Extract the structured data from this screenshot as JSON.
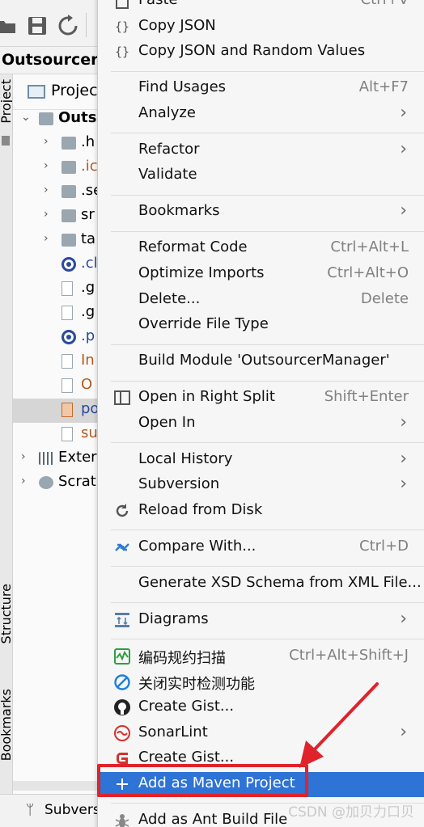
{
  "ide": {
    "window_tab_title": "OutsourcerM",
    "project_panel_title": "Project",
    "side_labels": [
      "Project",
      "Structure",
      "Bookmarks"
    ],
    "tree": [
      {
        "label": "Outs",
        "arrow": "⌄",
        "kind": "module",
        "indent": 0,
        "bold": true
      },
      {
        "label": ".h",
        "arrow": "›",
        "kind": "folder",
        "indent": 1
      },
      {
        "label": ".ic",
        "arrow": "›",
        "kind": "folder",
        "indent": 1,
        "color": "#b3591f"
      },
      {
        "label": ".se",
        "arrow": "›",
        "kind": "folder",
        "indent": 1
      },
      {
        "label": "sr",
        "arrow": "›",
        "kind": "folder",
        "indent": 1
      },
      {
        "label": "ta",
        "arrow": "›",
        "kind": "folder",
        "indent": 1
      },
      {
        "label": ".cl",
        "arrow": "",
        "kind": "eclipse",
        "indent": 1,
        "color": "#2b4a9a"
      },
      {
        "label": ".g",
        "arrow": "",
        "kind": "file",
        "indent": 1
      },
      {
        "label": ".g",
        "arrow": "",
        "kind": "file",
        "indent": 1
      },
      {
        "label": ".p",
        "arrow": "",
        "kind": "eclipse",
        "indent": 1,
        "color": "#2b4a9a"
      },
      {
        "label": "In",
        "arrow": "",
        "kind": "file",
        "indent": 1,
        "color": "#b3591f"
      },
      {
        "label": "O",
        "arrow": "",
        "kind": "file",
        "indent": 1,
        "color": "#b3591f"
      },
      {
        "label": "po",
        "arrow": "",
        "kind": "xml",
        "indent": 1,
        "color": "#2b4a9a",
        "selected": true
      },
      {
        "label": "su",
        "arrow": "",
        "kind": "file",
        "indent": 1,
        "color": "#b3591f"
      },
      {
        "label": "Exter",
        "arrow": "›",
        "kind": "libs",
        "indent": 0
      },
      {
        "label": "Scrat",
        "arrow": "›",
        "kind": "scratch",
        "indent": 0
      }
    ],
    "status_bar": "Subversi"
  },
  "menu": {
    "items": [
      {
        "label": "Paste",
        "shortcut": "Ctrl+V",
        "icon": "paste-icon",
        "glyph": "",
        "submenu": false
      },
      {
        "label": "Copy JSON",
        "shortcut": "",
        "icon": "json-braces-icon",
        "glyph": "{ }",
        "submenu": false
      },
      {
        "label": "Copy JSON and Random Values",
        "shortcut": "",
        "icon": "json-braces-icon",
        "glyph": "{ }",
        "submenu": false
      },
      {
        "sep": true
      },
      {
        "label": "Find Usages",
        "shortcut": "Alt+F7",
        "icon": "",
        "glyph": "",
        "submenu": false
      },
      {
        "label": "Analyze",
        "shortcut": "",
        "icon": "",
        "glyph": "",
        "submenu": true
      },
      {
        "sep": true
      },
      {
        "label": "Refactor",
        "shortcut": "",
        "icon": "",
        "glyph": "",
        "submenu": true
      },
      {
        "label": "Validate",
        "shortcut": "",
        "icon": "",
        "glyph": "",
        "submenu": false
      },
      {
        "sep": true
      },
      {
        "label": "Bookmarks",
        "shortcut": "",
        "icon": "",
        "glyph": "",
        "submenu": true
      },
      {
        "sep": true
      },
      {
        "label": "Reformat Code",
        "shortcut": "Ctrl+Alt+L",
        "icon": "",
        "glyph": "",
        "submenu": false
      },
      {
        "label": "Optimize Imports",
        "shortcut": "Ctrl+Alt+O",
        "icon": "",
        "glyph": "",
        "submenu": false
      },
      {
        "label": "Delete...",
        "shortcut": "Delete",
        "icon": "",
        "glyph": "",
        "submenu": false
      },
      {
        "label": "Override File Type",
        "shortcut": "",
        "icon": "",
        "glyph": "",
        "submenu": false
      },
      {
        "sep": true
      },
      {
        "label": "Build Module 'OutsourcerManager'",
        "shortcut": "",
        "icon": "",
        "glyph": "",
        "submenu": false
      },
      {
        "sep": true
      },
      {
        "label": "Open in Right Split",
        "shortcut": "Shift+Enter",
        "icon": "split-icon",
        "glyph": "◫",
        "submenu": false
      },
      {
        "label": "Open In",
        "shortcut": "",
        "icon": "",
        "glyph": "",
        "submenu": true
      },
      {
        "sep": true
      },
      {
        "label": "Local History",
        "shortcut": "",
        "icon": "",
        "glyph": "",
        "submenu": true
      },
      {
        "label": "Subversion",
        "shortcut": "",
        "icon": "",
        "glyph": "",
        "submenu": true
      },
      {
        "label": "Reload from Disk",
        "shortcut": "",
        "icon": "reload-icon",
        "glyph": "⟳",
        "submenu": false
      },
      {
        "sep": true
      },
      {
        "label": "Compare With...",
        "shortcut": "Ctrl+D",
        "icon": "compare-icon",
        "glyph": "⇄",
        "submenu": false
      },
      {
        "sep": true
      },
      {
        "label": "Generate XSD Schema from XML File...",
        "shortcut": "",
        "icon": "",
        "glyph": "",
        "submenu": false
      },
      {
        "sep": true
      },
      {
        "label": "Diagrams",
        "shortcut": "",
        "icon": "diagrams-icon",
        "glyph": "⊞",
        "submenu": true
      },
      {
        "sep": true
      },
      {
        "label": "编码规约扫描",
        "shortcut": "Ctrl+Alt+Shift+J",
        "icon": "code-scan-icon",
        "glyph": "",
        "submenu": false
      },
      {
        "label": "关闭实时检测功能",
        "shortcut": "",
        "icon": "disable-icon",
        "glyph": "⊘",
        "submenu": false
      },
      {
        "label": "Create Gist...",
        "shortcut": "",
        "icon": "github-icon",
        "glyph": "",
        "submenu": false
      },
      {
        "label": "SonarLint",
        "shortcut": "",
        "icon": "sonarlint-icon",
        "glyph": "",
        "submenu": true
      },
      {
        "label": "Create Gist...",
        "shortcut": "",
        "icon": "gitee-icon",
        "glyph": "G",
        "submenu": false
      },
      {
        "label": "Add as Maven Project",
        "shortcut": "",
        "icon": "plus-icon",
        "glyph": "+",
        "submenu": false,
        "highlight": true
      },
      {
        "sep": true
      },
      {
        "label": "Add as Ant Build File",
        "shortcut": "",
        "icon": "ant-icon",
        "glyph": "✱",
        "submenu": false
      }
    ]
  },
  "colors": {
    "highlight": "#2e73d6",
    "annotation_red": "#e0232b"
  },
  "watermark": "CSDN @加贝力口贝"
}
